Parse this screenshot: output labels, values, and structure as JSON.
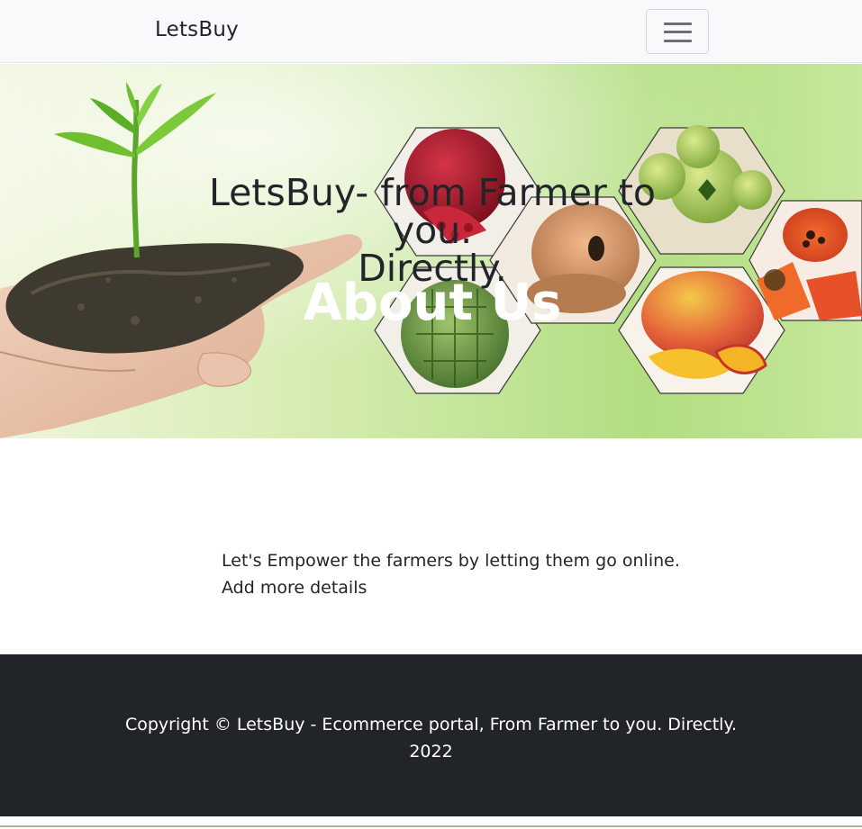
{
  "navbar": {
    "brand": "LetsBuy",
    "menu_icon": "hamburger-menu-icon"
  },
  "hero": {
    "title_line1": "LetsBuy- from Farmer to you.",
    "title_line2": "Directly.",
    "heading": "About Us",
    "image": "hand-holding-seedling-and-fruit-hexagons"
  },
  "content": {
    "line1": "Let's Empower the farmers by letting them go online.",
    "line2": "Add more details"
  },
  "footer": {
    "copyright_line1": "Copyright © LetsBuy - Ecommerce portal, From Farmer to you. Directly.",
    "copyright_line2": "2022"
  },
  "colors": {
    "navbar_bg": "#f8f9fa",
    "footer_bg": "#212529",
    "text": "#212529",
    "hero_green": "#b2dd80"
  }
}
